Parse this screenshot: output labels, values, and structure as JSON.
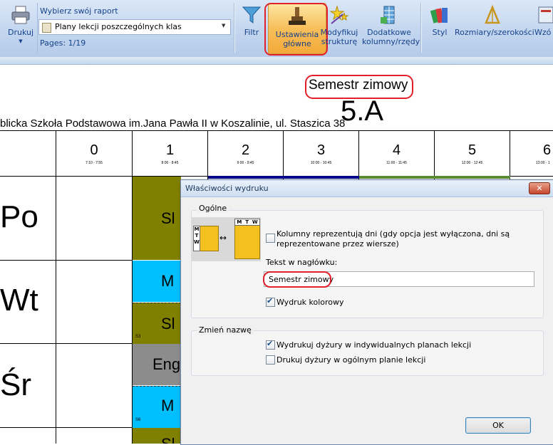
{
  "ribbon": {
    "print_label": "Drukuj",
    "report_caption": "Wybierz swój raport",
    "report_selected": "Plany lekcji poszczególnych klas",
    "pages": "Pages: 1/19",
    "filter_label": "Filtr",
    "main_settings_line1": "Ustawienia",
    "main_settings_line2": "główne",
    "modify_line1": "Modyfikuj",
    "modify_line2": "strukturę",
    "extra_line1": "Dodatkowe",
    "extra_line2": "kolumny/rzędy",
    "style_label": "Styl",
    "size_label": "Rozmiary/szerokości",
    "cut_label": "Wzó"
  },
  "page": {
    "header_text": "Semestr zimowy",
    "class_name": "5.A",
    "school": "blicka Szkoła Podstawowa im.Jana Pawła II w Koszalinie, ul. Staszica 38",
    "periods": [
      {
        "num": "0",
        "time": "7:10 - 7:55"
      },
      {
        "num": "1",
        "time": "8:00 - 8:45"
      },
      {
        "num": "2",
        "time": "9:00 - 9:45"
      },
      {
        "num": "3",
        "time": "10:00 - 10:45"
      },
      {
        "num": "4",
        "time": "11:00 - 11:45"
      },
      {
        "num": "5",
        "time": "12:00 - 12:45"
      },
      {
        "num": "6",
        "time": "13:00 - 1"
      }
    ],
    "days": [
      "Po",
      "Wt",
      "Śr"
    ],
    "lessons": [
      {
        "text": "Sl",
        "room": "",
        "color": "#808000"
      },
      {
        "text": "M",
        "room": "",
        "color": "#00bfff"
      },
      {
        "text": "Sl",
        "room": "S3",
        "color": "#808000"
      },
      {
        "text": "Eng",
        "room": "",
        "color": "#8c8c8c"
      },
      {
        "text": "M",
        "room": "S6",
        "color": "#00bfff"
      },
      {
        "text": "Sl",
        "room": "",
        "color": "#808000"
      }
    ]
  },
  "dialog": {
    "title": "Właściwości wydruku",
    "general_group": "Ogólne",
    "columns_days_label_1": "Kolumny reprezentują dni (gdy opcja jest wyłączona, dni są",
    "columns_days_label_2": "reprezentowane przez wiersze)",
    "columns_days_checked": false,
    "header_text_label": "Tekst w nagłówku:",
    "header_text_value": "Semestr zimowy",
    "color_print_label": "Wydruk kolorowy",
    "color_print_checked": true,
    "rename_group": "Zmień nazwę",
    "duties_individual_label": "Wydrukuj dyżury w indywidualnych planach lekcji",
    "duties_individual_checked": true,
    "duties_general_label": "Drukuj dyżury w ogólnym planie lekcji",
    "duties_general_checked": false,
    "ok_label": "OK",
    "preview_letters": [
      "M",
      "T",
      "W"
    ]
  },
  "colors": {
    "highlight": "#e0202a",
    "olive": "#808000",
    "sky": "#00bfff",
    "gray": "#8c8c8c",
    "ribbon_text": "#15428b"
  }
}
